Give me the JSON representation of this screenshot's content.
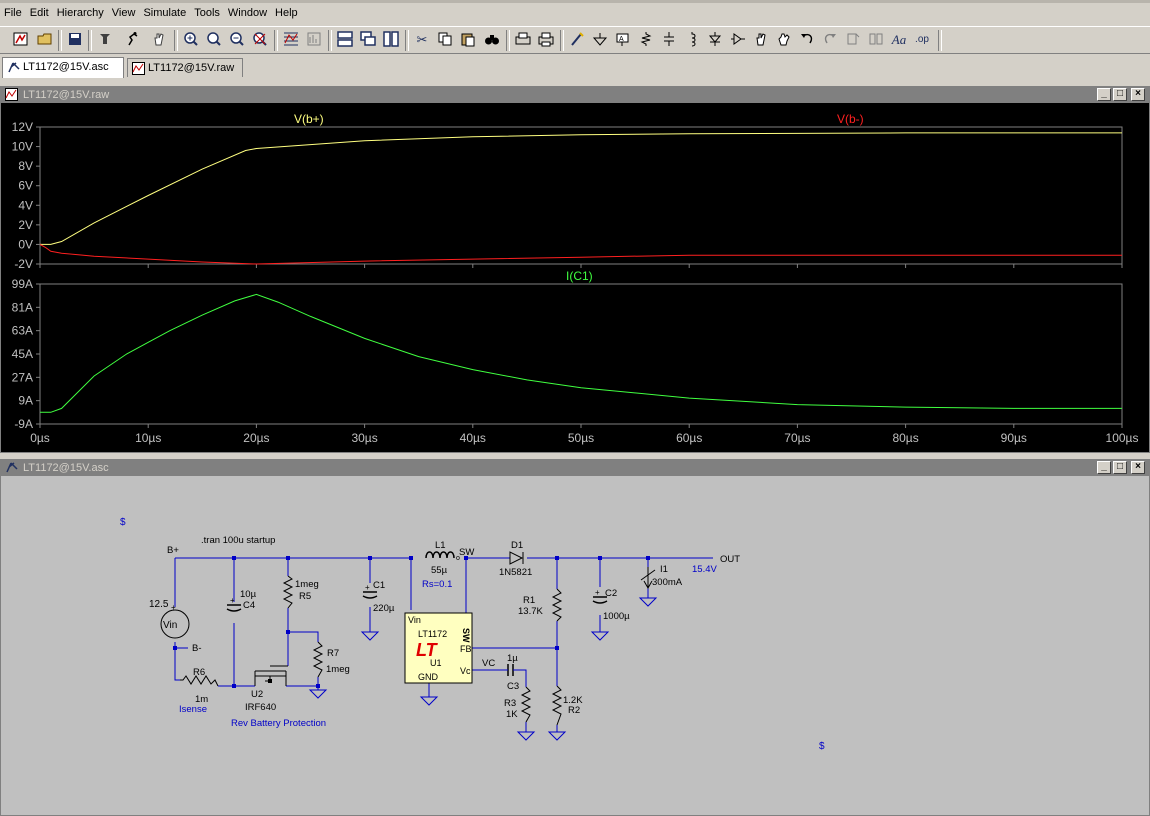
{
  "menu": [
    "File",
    "Edit",
    "Hierarchy",
    "View",
    "Simulate",
    "Tools",
    "Window",
    "Help"
  ],
  "tabs": [
    {
      "label": "LT1172@15V.asc"
    },
    {
      "label": "LT1172@15V.raw"
    }
  ],
  "toolbar": {
    "icons": [
      "new-schematic",
      "open",
      "save",
      "control-panel",
      "run",
      "halt",
      "zoom-in",
      "zoom-pan",
      "zoom-out",
      "zoom-fit",
      "autorange",
      "view-fft",
      "tile-vertical",
      "cascade",
      "tile-horizontal",
      "cut",
      "copy",
      "paste",
      "find",
      "print-setup",
      "print",
      "draw-wire",
      "ground",
      "label-net",
      "resistor",
      "capacitor",
      "inductor",
      "diode",
      "component",
      "move",
      "drag",
      "undo",
      "redo",
      "rotate",
      "mirror",
      "text",
      "spice-directive"
    ]
  },
  "waveform_window": {
    "title": "LT1172@15V.raw",
    "pane1": {
      "trace1_label": "V(b+)",
      "trace2_label": "V(b-)",
      "y_ticks": [
        "12V",
        "10V",
        "8V",
        "6V",
        "4V",
        "2V",
        "0V",
        "-2V"
      ]
    },
    "pane2": {
      "trace_label": "I(C1)",
      "y_ticks": [
        "99A",
        "81A",
        "63A",
        "45A",
        "27A",
        "9A",
        "-9A"
      ]
    },
    "x_ticks": [
      "0µs",
      "10µs",
      "20µs",
      "30µs",
      "40µs",
      "50µs",
      "60µs",
      "70µs",
      "80µs",
      "90µs",
      "100µs"
    ]
  },
  "chart_data": [
    {
      "type": "line",
      "title": "",
      "xlabel": "",
      "ylabel": "",
      "xlim": [
        0,
        100
      ],
      "ylim": [
        -2,
        12
      ],
      "x_unit": "µs",
      "y_unit": "V",
      "series": [
        {
          "name": "V(b+)",
          "color": "#ffff80",
          "x": [
            0,
            1,
            2,
            5,
            10,
            15,
            19,
            20,
            25,
            30,
            40,
            50,
            60,
            70,
            80,
            90,
            100
          ],
          "y": [
            0,
            0,
            0.3,
            2.2,
            5.0,
            7.7,
            9.6,
            9.8,
            10.2,
            10.6,
            11.0,
            11.2,
            11.3,
            11.35,
            11.4,
            11.4,
            11.4
          ]
        },
        {
          "name": "V(b-)",
          "color": "#ff2020",
          "x": [
            0,
            0.5,
            1,
            2,
            5,
            10,
            15,
            20,
            30,
            40,
            50,
            60,
            70,
            80,
            90,
            100
          ],
          "y": [
            0,
            -0.3,
            -0.7,
            -0.9,
            -1.2,
            -1.5,
            -1.8,
            -2.0,
            -1.7,
            -1.5,
            -1.3,
            -1.1,
            -1.1,
            -1.1,
            -1.1,
            -1.1
          ]
        }
      ]
    },
    {
      "type": "line",
      "title": "",
      "xlabel": "",
      "ylabel": "",
      "xlim": [
        0,
        100
      ],
      "ylim": [
        -9,
        99
      ],
      "x_unit": "µs",
      "y_unit": "A",
      "series": [
        {
          "name": "I(C1)",
          "color": "#40ff40",
          "x": [
            0,
            1,
            2,
            5,
            8,
            10,
            12,
            15,
            18,
            20,
            22,
            25,
            30,
            35,
            40,
            45,
            50,
            60,
            70,
            80,
            90,
            100
          ],
          "y": [
            0,
            0,
            3,
            28,
            45,
            54,
            63,
            75,
            86,
            91,
            85,
            74,
            57,
            43,
            33,
            25,
            19,
            11,
            6,
            4,
            3,
            3
          ]
        }
      ]
    }
  ],
  "schematic_window": {
    "title": "LT1172@15V.asc",
    "labels": {
      "dollar1": "$",
      "dollar2": "$",
      "directive": ".tran 100u startup",
      "bplus": "B+",
      "bminus": "B-",
      "vin_value": "12.5",
      "vin_name": "Vin",
      "c4_value": "10µ",
      "c4_name": "C4",
      "r5_value": "1meg",
      "r5_name": "R5",
      "r7_name": "R7",
      "r7_value": "1meg",
      "r6_name": "R6",
      "r6_value": "1m",
      "isense": "Isense",
      "u2_name": "U2",
      "u2_part": "IRF640",
      "rev_batt": "Rev Battery Protection",
      "c1_name": "C1",
      "c1_value": "220µ",
      "l1_name": "L1",
      "l1_value": "55µ",
      "rs": "Rs=0.1",
      "sw_net": "SW",
      "d1_name": "D1",
      "d1_part": "1N5821",
      "r1_name": "R1",
      "r1_value": "13.7K",
      "c2_name": "C2",
      "c2_value": "1000µ",
      "i1_name": "I1",
      "i1_value": "300mA",
      "out_net": "OUT",
      "out_voltage": "15.4V",
      "u1_vin": "Vin",
      "u1_sw": "SW",
      "u1_part": "LT1172",
      "u1_logo": "LT",
      "u1_name": "U1",
      "u1_fb": "FB",
      "u1_vc": "Vc",
      "u1_gnd": "GND",
      "vc_net": "VC",
      "c3_value": "1µ",
      "c3_name": "C3",
      "r3_name": "R3",
      "r3_value": "1K",
      "r2_value": "1.2K",
      "r2_name": "R2"
    }
  },
  "colors": {
    "bg": "#d4d0c8",
    "plot_bg": "#000000",
    "grid": "#808080",
    "trace_bplus": "#ffff80",
    "trace_bminus": "#ff2020",
    "trace_ic1": "#40ff40",
    "schem_bg": "#c0c0c0",
    "wire": "#0000c8",
    "component": "#000000",
    "net_label_blue": "#0000c8"
  }
}
